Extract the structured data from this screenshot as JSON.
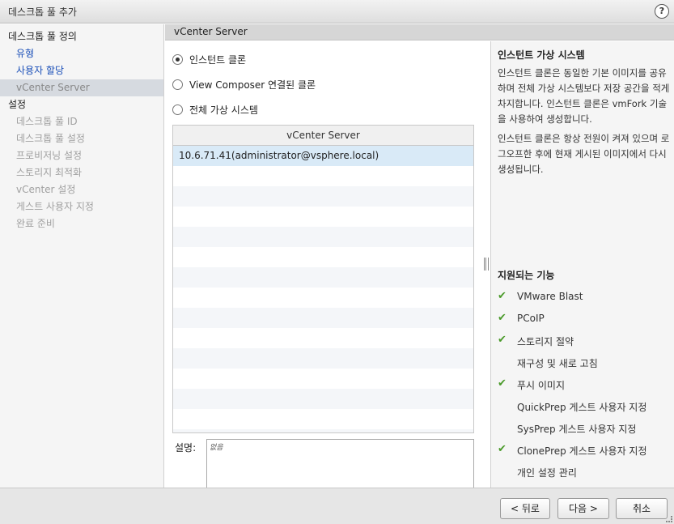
{
  "window": {
    "title": "데스크톱 풀 추가",
    "help": "?"
  },
  "sidebar": {
    "section1": "데스크톱 풀 정의",
    "items1": [
      "유형",
      "사용자 할당",
      "vCenter Server"
    ],
    "section2": "설정",
    "items2": [
      "데스크톱 풀 ID",
      "데스크톱 풀 설정",
      "프로비저닝 설정",
      "스토리지 최적화",
      "vCenter 설정",
      "게스트 사용자 지정",
      "완료 준비"
    ]
  },
  "main": {
    "header": "vCenter Server",
    "radios": [
      {
        "label": "인스턴트 클론",
        "checked": true
      },
      {
        "label": "View Composer 연결된 클론",
        "checked": false
      },
      {
        "label": "전체 가상 시스템",
        "checked": false
      }
    ],
    "table": {
      "header": "vCenter Server",
      "rows": [
        "10.6.71.41(administrator@vsphere.local)"
      ]
    },
    "description": {
      "label": "설명:",
      "value": "없음"
    }
  },
  "info": {
    "title": "인스턴트 가상 시스템",
    "para1": "인스턴트 클론은 동일한 기본 이미지를 공유하며 전체 가상 시스템보다 저장 공간을 적게 차지합니다. 인스턴트 클론은 vmFork 기술을 사용하여 생성합니다.",
    "para2": "인스턴트 클론은 항상 전원이 켜져 있으며 로그오프한 후에 현재 게시된 이미지에서 다시 생성됩니다.",
    "features_title": "지원되는 기능",
    "features": [
      {
        "label": "VMware Blast",
        "supported": true
      },
      {
        "label": "PCoIP",
        "supported": true
      },
      {
        "label": "스토리지 절약",
        "supported": true
      },
      {
        "label": "재구성 및 새로 고침",
        "supported": false
      },
      {
        "label": "푸시 이미지",
        "supported": true
      },
      {
        "label": "QuickPrep 게스트 사용자 지정",
        "supported": false
      },
      {
        "label": "SysPrep 게스트 사용자 지정",
        "supported": false
      },
      {
        "label": "ClonePrep 게스트 사용자 지정",
        "supported": true
      },
      {
        "label": "개인 설정 관리",
        "supported": false
      }
    ]
  },
  "footer": {
    "back": "< 뒤로",
    "next": "다음 >",
    "cancel": "취소"
  },
  "colors": {
    "check": "#4a9a2a",
    "link": "#1a4fb8"
  },
  "icons": {
    "check": "check-icon",
    "help": "help-icon",
    "radio": "radio-icon"
  }
}
